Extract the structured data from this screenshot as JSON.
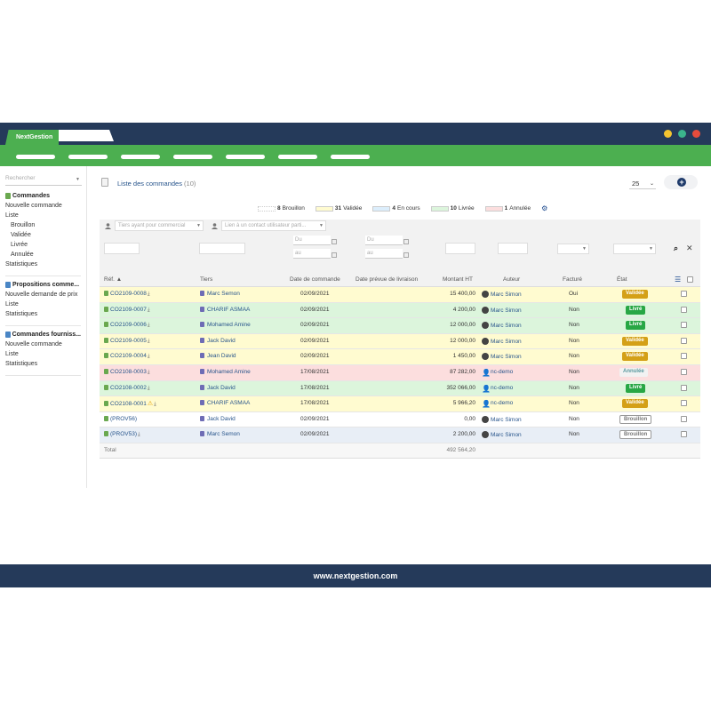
{
  "app": {
    "tab_label": "NextGestion",
    "footer": "www.nextgestion.com"
  },
  "colors": {
    "navy": "#253a5a",
    "green": "#4caf50",
    "dot_yellow": "#f4c430",
    "dot_green": "#3bb58c",
    "dot_red": "#e74c3c"
  },
  "sidebar": {
    "search_placeholder": "Rechercher",
    "sections": [
      {
        "title": "Commandes",
        "items": [
          "Nouvelle commande",
          "Liste"
        ],
        "subitems": [
          "Brouillon",
          "Validée",
          "Livrée",
          "Annulée"
        ],
        "after": [
          "Statistiques"
        ]
      },
      {
        "title": "Propositions comme...",
        "items": [
          "Nouvelle demande de prix",
          "Liste",
          "Statistiques"
        ]
      },
      {
        "title": "Commandes fourniss...",
        "items": [
          "Nouvelle commande",
          "Liste",
          "Statistiques"
        ]
      }
    ]
  },
  "header": {
    "title": "Liste des commandes",
    "count": "(10)",
    "per_page": "25",
    "add_icon": "plus-icon"
  },
  "legend": [
    {
      "count": "8",
      "label": "Brouillon",
      "color": "#ffffff"
    },
    {
      "count": "31",
      "label": "Validée",
      "color": "#fffbd0"
    },
    {
      "count": "4",
      "label": "En cours",
      "color": "#dceefc"
    },
    {
      "count": "10",
      "label": "Livrée",
      "color": "#dcf5dc"
    },
    {
      "count": "1",
      "label": "Annulée",
      "color": "#fcdede"
    }
  ],
  "filters": {
    "commercial_placeholder": "Tiers ayant pour commercial",
    "contact_placeholder": "Lien à un contact utilisateur parti...",
    "du": "Du",
    "au": "au"
  },
  "columns": [
    "Réf.",
    "Tiers",
    "Date de commande",
    "Date prévue de livraison",
    "Montant HT",
    "Auteur",
    "Facturé",
    "État"
  ],
  "rows": [
    {
      "ref": "CO2109-0008",
      "tiers": "Marc Semon",
      "date": "02/09/2021",
      "montant": "15 400,00",
      "auteur": "Marc Simon",
      "facture": "Oui",
      "etat": "Validée",
      "bg": "#fffbd0",
      "badge": "#d4a017",
      "badge_text": "#ffffff",
      "user": "photo"
    },
    {
      "ref": "CO2109-0007",
      "tiers": "CHARIF ASMAA",
      "date": "02/09/2021",
      "montant": "4 200,00",
      "auteur": "Marc Simon",
      "facture": "Non",
      "etat": "Livré",
      "bg": "#dcf5dc",
      "badge": "#28a745",
      "badge_text": "#ffffff",
      "user": "photo"
    },
    {
      "ref": "CO2109-0006",
      "tiers": "Mohamed Amine",
      "date": "02/09/2021",
      "montant": "12 000,00",
      "auteur": "Marc Simon",
      "facture": "Non",
      "etat": "Livré",
      "bg": "#dcf5dc",
      "badge": "#28a745",
      "badge_text": "#ffffff",
      "user": "photo"
    },
    {
      "ref": "CO2109-0005",
      "tiers": "Jack David",
      "date": "02/09/2021",
      "montant": "12 000,00",
      "auteur": "Marc Simon",
      "facture": "Non",
      "etat": "Validée",
      "bg": "#fffbd0",
      "badge": "#d4a017",
      "badge_text": "#ffffff",
      "user": "photo"
    },
    {
      "ref": "CO2109-0004",
      "tiers": "Jean David",
      "date": "02/09/2021",
      "montant": "1 450,00",
      "auteur": "Marc Simon",
      "facture": "Non",
      "etat": "Validée",
      "bg": "#fffbd0",
      "badge": "#d4a017",
      "badge_text": "#ffffff",
      "user": "photo"
    },
    {
      "ref": "CO2108-0003",
      "tiers": "Mohamed Amine",
      "date": "17/08/2021",
      "montant": "87 282,00",
      "auteur": "nc-demo",
      "facture": "Non",
      "etat": "Annulée",
      "bg": "#fcdede",
      "badge": "#f2f2f2",
      "badge_text": "#5a9aa0",
      "user": "generic"
    },
    {
      "ref": "CO2108-0002",
      "tiers": "Jack David",
      "date": "17/08/2021",
      "montant": "352 066,00",
      "auteur": "nc-demo",
      "facture": "Non",
      "etat": "Livré",
      "bg": "#dcf5dc",
      "badge": "#28a745",
      "badge_text": "#ffffff",
      "user": "generic"
    },
    {
      "ref": "CO2108-0001",
      "tiers": "CHARIF ASMAA",
      "date": "17/08/2021",
      "montant": "5 966,20",
      "auteur": "nc-demo",
      "facture": "Non",
      "etat": "Validée",
      "bg": "#fffbd0",
      "badge": "#d4a017",
      "badge_text": "#ffffff",
      "user": "generic",
      "warn": true
    },
    {
      "ref": "(PROV56)",
      "tiers": "Jack David",
      "date": "02/09/2021",
      "montant": "0,00",
      "auteur": "Marc Simon",
      "facture": "Non",
      "etat": "Brouillon",
      "bg": "#ffffff",
      "badge": "#ffffff",
      "badge_text": "#777777",
      "user": "photo",
      "nodl": true
    },
    {
      "ref": "(PROV53)",
      "tiers": "Marc Semon",
      "date": "02/09/2021",
      "montant": "2 200,00",
      "auteur": "Marc Simon",
      "facture": "Non",
      "etat": "Brouillon",
      "bg": "#e8eef6",
      "badge": "#ffffff",
      "badge_text": "#777777",
      "user": "photo"
    }
  ],
  "total": {
    "label": "Total",
    "value": "492 564,20"
  }
}
